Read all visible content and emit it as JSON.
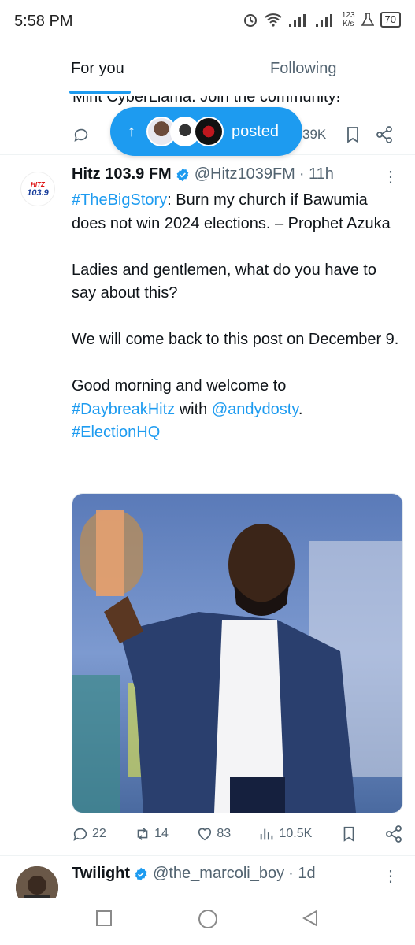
{
  "status_bar": {
    "time": "5:58 PM",
    "net_speed_top": "123",
    "net_speed_bottom": "K/s",
    "battery": "70",
    "icons": [
      "alarm-icon",
      "wifi-icon",
      "signal-icon",
      "signal-icon",
      "flask-icon",
      "battery-icon"
    ]
  },
  "tabs": [
    {
      "label": "For you",
      "active": true
    },
    {
      "label": "Following",
      "active": false
    }
  ],
  "previous_tweet": {
    "cut_text": "Mint CyberLlama. Join the community!",
    "views": "39K"
  },
  "posted_pill": {
    "label": "posted",
    "icons": [
      "arrow-up-icon"
    ]
  },
  "tweet": {
    "author_name": "Hitz 103.9 FM",
    "handle": "@Hitz1039FM",
    "time": "· 11h",
    "avatar_text_top": "HITZ",
    "avatar_text_bottom": "103.9",
    "line1_hashtag": "#TheBigStory",
    "line1_rest": ": Burn my church if Bawumia does not win 2024 elections. – Prophet Azuka",
    "para2": "Ladies and gentlemen, what do you have to say about this?",
    "para3": "We will come back to this post on December 9.",
    "para4_start": "Good morning and welcome to",
    "para4_hashtag": "#DaybreakHitz",
    "para4_with": " with ",
    "para4_mention": "@andydosty",
    "para4_dot": ".",
    "para4_hashtag2": "#ElectionHQ",
    "replies": "22",
    "reposts": "14",
    "likes": "83",
    "views": "10.5K"
  },
  "next_tweet": {
    "author_name": "Twilight",
    "handle": "@the_marcoli_boy",
    "time": "· 1d"
  },
  "colors": {
    "accent": "#1d9bf0",
    "text": "#0f1419",
    "muted": "#536471"
  }
}
